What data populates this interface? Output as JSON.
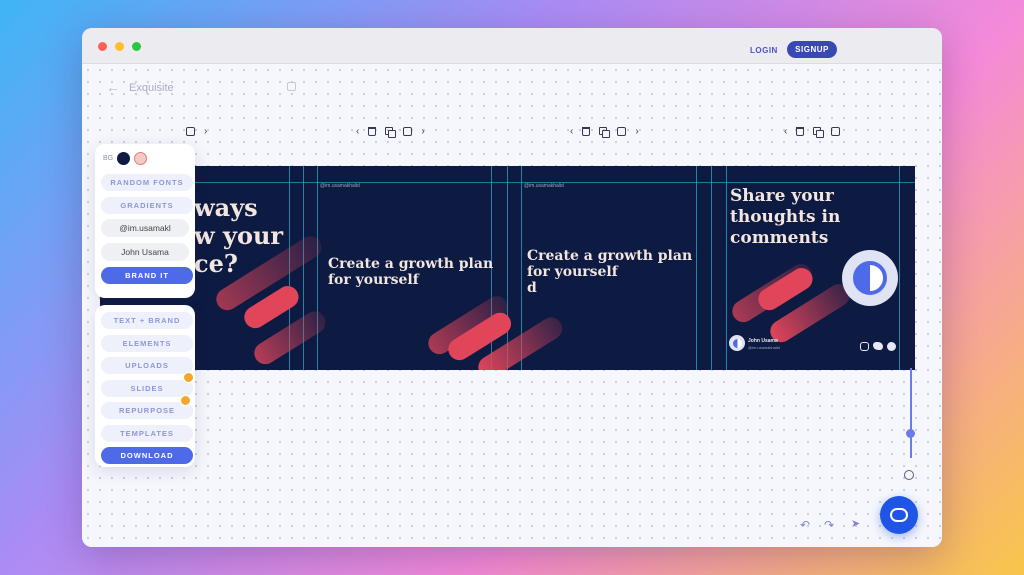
{
  "window": {
    "traffic_lights": [
      "#ff5f57",
      "#febc2e",
      "#28c840"
    ]
  },
  "header": {
    "back_icon": "arrow-left-icon",
    "title": "Exquisite",
    "save_icon": "save-icon",
    "login_label": "LOGIN",
    "signup_label": "SIGNUP"
  },
  "toolbar_icons": [
    "chevron-left-icon",
    "trash-icon",
    "duplicate-icon",
    "square-icon",
    "chevron-right-icon"
  ],
  "slides": [
    {
      "lines": [
        "ways",
        "w your",
        "ce?"
      ]
    },
    {
      "handle": "@im.usamakhalid",
      "lines": [
        "Create a growth plan",
        "for yourself"
      ]
    },
    {
      "handle": "@im.usamakhalid",
      "lines": [
        "Create a growth plan",
        "for yourself",
        "d"
      ]
    },
    {
      "lines": [
        "Share your",
        "thoughts in",
        "comments"
      ],
      "author_name": "John Usama",
      "author_handle": "@im.usamakhalid",
      "social_icons": [
        "instagram-icon",
        "twitter-icon",
        "facebook-icon"
      ]
    }
  ],
  "sidebar": {
    "bg_label": "BG",
    "colors": [
      "#0d1a42",
      "#f6c9c6"
    ],
    "random_fonts": "RANDOM FONTS",
    "gradients": "GRADIENTS",
    "handle_value": "@im.usamakl",
    "name_value": "John Usama",
    "brand_it": "BRAND IT",
    "menu": [
      "TEXT + BRAND",
      "ELEMENTS",
      "UPLOADS",
      "SLIDES",
      "REPURPOSE",
      "TEMPLATES"
    ],
    "download": "DOWNLOAD"
  },
  "bottom_tools": [
    "undo-icon",
    "redo-icon",
    "cursor-icon"
  ],
  "zoom_icon": "zoom-icon",
  "chat_icon": "chat-icon"
}
